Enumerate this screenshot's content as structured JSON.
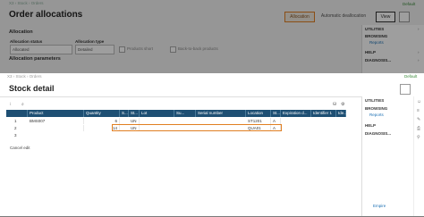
{
  "background": {
    "breadcrumb": "X3 › Stock › Orders",
    "default_label": "Default",
    "title": "Order allocations",
    "buttons": {
      "allocation": "Allocation",
      "automatic_deallocation": "Automatic deallocation",
      "view": "View"
    },
    "section_allocation": "Allocation",
    "allocation_status_label": "Allocation status",
    "allocation_status_value": "Allocated",
    "allocation_type_label": "Allocation type",
    "allocation_type_value": "Detailed",
    "products_short_label": "Products short",
    "back_to_back_label": "Back-to-back products",
    "section_parameters": "Allocation parameters",
    "sidebar": {
      "utilities": "UTILITIES",
      "browsing": "BROWSING",
      "reports": "Reports",
      "help": "HELP",
      "diagnosis": "DIAGNOSIS..."
    }
  },
  "modal": {
    "breadcrumb": "X3 › Stock › Orders",
    "default_label": "Default",
    "title": "Stock detail",
    "columns": [
      "Product",
      "Quantity",
      "S...",
      "St...",
      "Lot",
      "Su...",
      "Serial number",
      "Location",
      "St...",
      "Expiration d...",
      "Identifier 1",
      "Ide..."
    ],
    "rows": [
      {
        "num": "1",
        "product": "BMS007",
        "quantity": "6",
        "unit": "UN",
        "location": "ST1201",
        "status": "A"
      },
      {
        "num": "2",
        "product": "",
        "quantity": "14",
        "unit": "UN",
        "location": "QUA01",
        "status": "A"
      },
      {
        "num": "3",
        "product": "",
        "quantity": "",
        "unit": "",
        "location": "",
        "status": ""
      }
    ],
    "cancel_label": "Cancel edit",
    "sidebar": {
      "utilities": "UTILITIES",
      "browsing": "BROWSING",
      "reports": "Reports",
      "help": "HELP",
      "diagnosis": "DIAGNOSIS..."
    },
    "logout": "Empire"
  },
  "colors": {
    "accent": "#e07f22",
    "header": "#1e4f73",
    "link": "#1a6fb3"
  }
}
